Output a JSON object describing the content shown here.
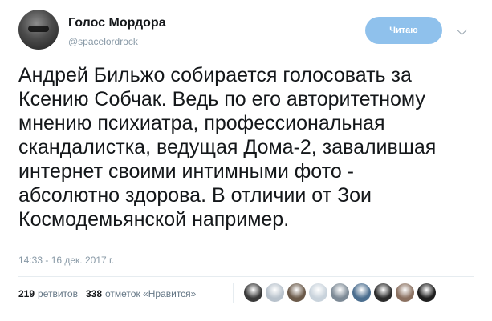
{
  "author": {
    "display_name": "Голос Мордора",
    "screen_name": "@spacelordrock",
    "avatar_icon": "user-avatar-icon"
  },
  "header": {
    "follow_label": "Читаю",
    "menu_icon": "chevron-down-icon"
  },
  "tweet": {
    "text": "Андрей Бильжо собирается голосовать за\nКсению Собчак. Ведь по его авторитетному\nмнению психиатра, профессиональная\nскандалистка, ведущая Дома-2, завалившая\nинтернет своими интимными фото -\nабсолютно здорова. В отличии от Зои\nКосмодемьянской например.",
    "timestamp": "14:33 - 16 дек. 2017 г."
  },
  "stats": {
    "retweets_count": "219",
    "retweets_label": "ретвитов",
    "likes_count": "338",
    "likes_label": "отметок «Нравится»"
  },
  "colors": {
    "follow_button": "#8fc1ec",
    "secondary_text": "#8899a6",
    "divider": "#e6ecf0"
  },
  "likers": [
    {
      "icon": "liker-avatar-icon",
      "color": "#3a3a3a"
    },
    {
      "icon": "liker-avatar-icon",
      "color": "#b8c2cc"
    },
    {
      "icon": "liker-avatar-icon",
      "color": "#6b5a4a"
    },
    {
      "icon": "liker-avatar-icon",
      "color": "#c9d3dc"
    },
    {
      "icon": "liker-avatar-icon",
      "color": "#7d8a96"
    },
    {
      "icon": "liker-avatar-icon",
      "color": "#4b6e8f"
    },
    {
      "icon": "liker-avatar-icon",
      "color": "#2c2c2c"
    },
    {
      "icon": "liker-avatar-icon",
      "color": "#8a7060"
    },
    {
      "icon": "liker-avatar-icon",
      "color": "#1f1f1f"
    }
  ]
}
